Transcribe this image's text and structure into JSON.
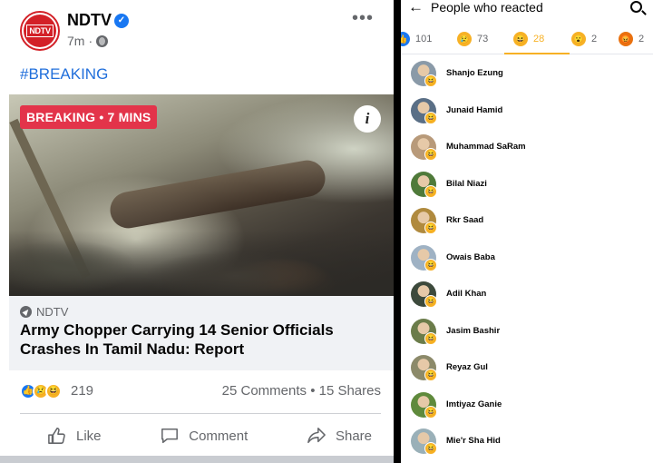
{
  "post": {
    "page_name": "NDTV",
    "avatar_text": "NDTV",
    "time": "7m",
    "text": "#BREAKING",
    "badge": "BREAKING • 7 MINS",
    "source": "NDTV",
    "headline": "Army Chopper Carrying 14 Senior Officials Crashes In Tamil Nadu: Report",
    "reaction_count": "219",
    "comments_shares": "25 Comments • 15 Shares",
    "actions": {
      "like": "Like",
      "comment": "Comment",
      "share": "Share"
    },
    "icons": [
      "verified-icon",
      "globe-icon",
      "more-icon",
      "info-icon",
      "like-icon",
      "comment-icon",
      "share-icon"
    ]
  },
  "reactions_panel": {
    "title": "People who reacted",
    "tabs": [
      {
        "emoji": "like",
        "count": "101"
      },
      {
        "emoji": "sad",
        "count": "73"
      },
      {
        "emoji": "haha",
        "count": "28",
        "active": true
      },
      {
        "emoji": "wow",
        "count": "2"
      },
      {
        "emoji": "angry",
        "count": "2"
      }
    ],
    "people": [
      {
        "name": "Shanjo Ezung",
        "color": "#8a9aa8"
      },
      {
        "name": "Junaid Hamid",
        "color": "#5a6f86"
      },
      {
        "name": "Muhammad SaRam",
        "color": "#b89a7a"
      },
      {
        "name": "Bilal Niazi",
        "color": "#4f7a3a"
      },
      {
        "name": "Rkr Saad",
        "color": "#b08a3e"
      },
      {
        "name": "Owais Baba",
        "color": "#9fb2c4"
      },
      {
        "name": "Adil Khan",
        "color": "#3d4a3c"
      },
      {
        "name": "Jasim Bashir",
        "color": "#6b7c4a"
      },
      {
        "name": "Reyaz Gul",
        "color": "#8c8a6a"
      },
      {
        "name": "Imtiyaz Ganie",
        "color": "#5f8a3c"
      },
      {
        "name": "Mie'r Sha Hid",
        "color": "#9ab0b8"
      }
    ]
  }
}
